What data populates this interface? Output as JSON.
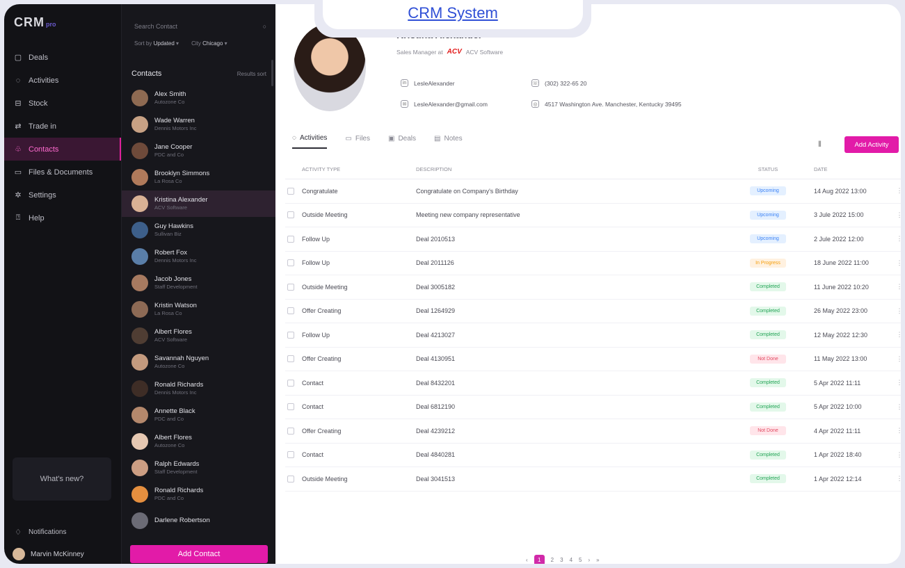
{
  "header": {
    "title": "CRM System"
  },
  "brand": {
    "logo": "CRM",
    "tag": "pro"
  },
  "nav": {
    "items": [
      {
        "label": "Deals",
        "icon": "box-icon"
      },
      {
        "label": "Activities",
        "icon": "activity-icon"
      },
      {
        "label": "Stock",
        "icon": "store-icon"
      },
      {
        "label": "Trade in",
        "icon": "trade-icon"
      },
      {
        "label": "Contacts",
        "icon": "users-icon",
        "active": true
      },
      {
        "label": "Files & Documents",
        "icon": "folder-icon"
      },
      {
        "label": "Settings",
        "icon": "gear-icon"
      },
      {
        "label": "Help",
        "icon": "help-icon"
      }
    ],
    "whats_new": "What's new?",
    "notifications": "Notifications",
    "user": "Marvin McKinney"
  },
  "contacts": {
    "search_placeholder": "Search Contact",
    "filter_sort_label": "Sort by",
    "filter_sort_value": "Updated",
    "filter_city_label": "City",
    "filter_city_value": "Chicago",
    "title": "Contacts",
    "sort_label": "Results sort",
    "items": [
      {
        "name": "Alex Smith",
        "company": "Autozone Co",
        "color": "#8e6a52"
      },
      {
        "name": "Wade Warren",
        "company": "Dennis Motors Inc",
        "color": "#c7a184"
      },
      {
        "name": "Jane Cooper",
        "company": "PDC and Co",
        "color": "#6e4a3a"
      },
      {
        "name": "Brooklyn Simmons",
        "company": "La Rosa Co",
        "color": "#b07a5b"
      },
      {
        "name": "Kristina Alexander",
        "company": "ACV Software",
        "color": "#d9b195",
        "selected": true
      },
      {
        "name": "Guy Hawkins",
        "company": "Sullivan Biz",
        "color": "#3d5f8a"
      },
      {
        "name": "Robert Fox",
        "company": "Dennis Motors Inc",
        "color": "#5a7ea8"
      },
      {
        "name": "Jacob Jones",
        "company": "Staff Development",
        "color": "#a77a60"
      },
      {
        "name": "Kristin Watson",
        "company": "La Rosa Co",
        "color": "#8d6a55"
      },
      {
        "name": "Albert Flores",
        "company": "ACV Software",
        "color": "#4f3d33"
      },
      {
        "name": "Savannah Nguyen",
        "company": "Autozone Co",
        "color": "#c39a7e"
      },
      {
        "name": "Ronald Richards",
        "company": "Dennis Motors Inc",
        "color": "#3e2d26"
      },
      {
        "name": "Annette Black",
        "company": "PDC and Co",
        "color": "#b4886c"
      },
      {
        "name": "Albert Flores",
        "company": "Autozone Co",
        "color": "#e6c8b2"
      },
      {
        "name": "Ralph Edwards",
        "company": "Staff Development",
        "color": "#cc9e83"
      },
      {
        "name": "Ronald Richards",
        "company": "PDC and Co",
        "color": "#e58f3f"
      },
      {
        "name": "Darlene Robertson",
        "company": "",
        "color": "#6b6b75"
      }
    ],
    "add_button": "Add Contact"
  },
  "profile": {
    "name": "Kristina Alexander",
    "role": "Sales Manager at",
    "brand": "ACV",
    "company": "ACV Software",
    "linkedin": "LesleAlexander",
    "phone": "(302) 322-65 20",
    "email": "LesleAlexander@gmail.com",
    "address": "4517 Washington Ave. Manchester, Kentucky 39495"
  },
  "tabs": [
    {
      "label": "Activities",
      "icon": "activity-icon",
      "active": true
    },
    {
      "label": "Files",
      "icon": "folder-icon"
    },
    {
      "label": "Deals",
      "icon": "calendar-icon"
    },
    {
      "label": "Notes",
      "icon": "note-icon"
    }
  ],
  "add_activity": "Add Activity",
  "table": {
    "headers": {
      "type": "ACTIVITY TYPE",
      "description": "DESCRIPTION",
      "status": "STATUS",
      "date": "DATE"
    },
    "rows": [
      {
        "type": "Congratulate",
        "description": "Congratulate on Company's Birthday",
        "status": "Upcoming",
        "date": "14 Aug 2022 13:00"
      },
      {
        "type": "Outside Meeting",
        "description": "Meeting new company representative",
        "status": "Upcoming",
        "date": "3 Jule 2022 15:00"
      },
      {
        "type": "Follow Up",
        "description": "Deal 2010513",
        "status": "Upcoming",
        "date": "2 Jule 2022 12:00"
      },
      {
        "type": "Follow Up",
        "description": "Deal 2011126",
        "status": "In Progress",
        "date": "18 June 2022 11:00"
      },
      {
        "type": "Outside Meeting",
        "description": "Deal 3005182",
        "status": "Completed",
        "date": "11 June 2022 10:20"
      },
      {
        "type": "Offer Creating",
        "description": "Deal 1264929",
        "status": "Completed",
        "date": "26 May 2022 23:00"
      },
      {
        "type": "Follow Up",
        "description": "Deal 4213027",
        "status": "Completed",
        "date": "12 May 2022 12:30"
      },
      {
        "type": "Offer Creating",
        "description": "Deal 4130951",
        "status": "Not Done",
        "date": "11 May 2022 13:00"
      },
      {
        "type": "Contact",
        "description": "Deal 8432201",
        "status": "Completed",
        "date": "5 Apr 2022 11:11"
      },
      {
        "type": "Contact",
        "description": "Deal 6812190",
        "status": "Completed",
        "date": "5 Apr 2022 10:00"
      },
      {
        "type": "Offer Creating",
        "description": "Deal 4239212",
        "status": "Not Done",
        "date": "4 Apr 2022 11:11"
      },
      {
        "type": "Contact",
        "description": "Deal 4840281",
        "status": "Completed",
        "date": "1 Apr 2022 18:40"
      },
      {
        "type": "Outside Meeting",
        "description": "Deal 3041513",
        "status": "Completed",
        "date": "1 Apr 2022 12:14"
      }
    ]
  },
  "status_colors": {
    "Upcoming": {
      "bg": "#e4f0ff",
      "fg": "#3b82f6"
    },
    "In Progress": {
      "bg": "#fff1e0",
      "fg": "#f59e0b"
    },
    "Completed": {
      "bg": "#e3f8ea",
      "fg": "#22a455"
    },
    "Not Done": {
      "bg": "#ffe5ea",
      "fg": "#e34a61"
    }
  },
  "pagination": {
    "prev": "‹",
    "pages": [
      "1",
      "2",
      "3",
      "4",
      "5"
    ],
    "current": "1",
    "next": "›",
    "last": "»"
  },
  "colors": {
    "accent": "#e21ba8",
    "nav_bg": "#121216",
    "contacts_bg": "#17171c"
  }
}
